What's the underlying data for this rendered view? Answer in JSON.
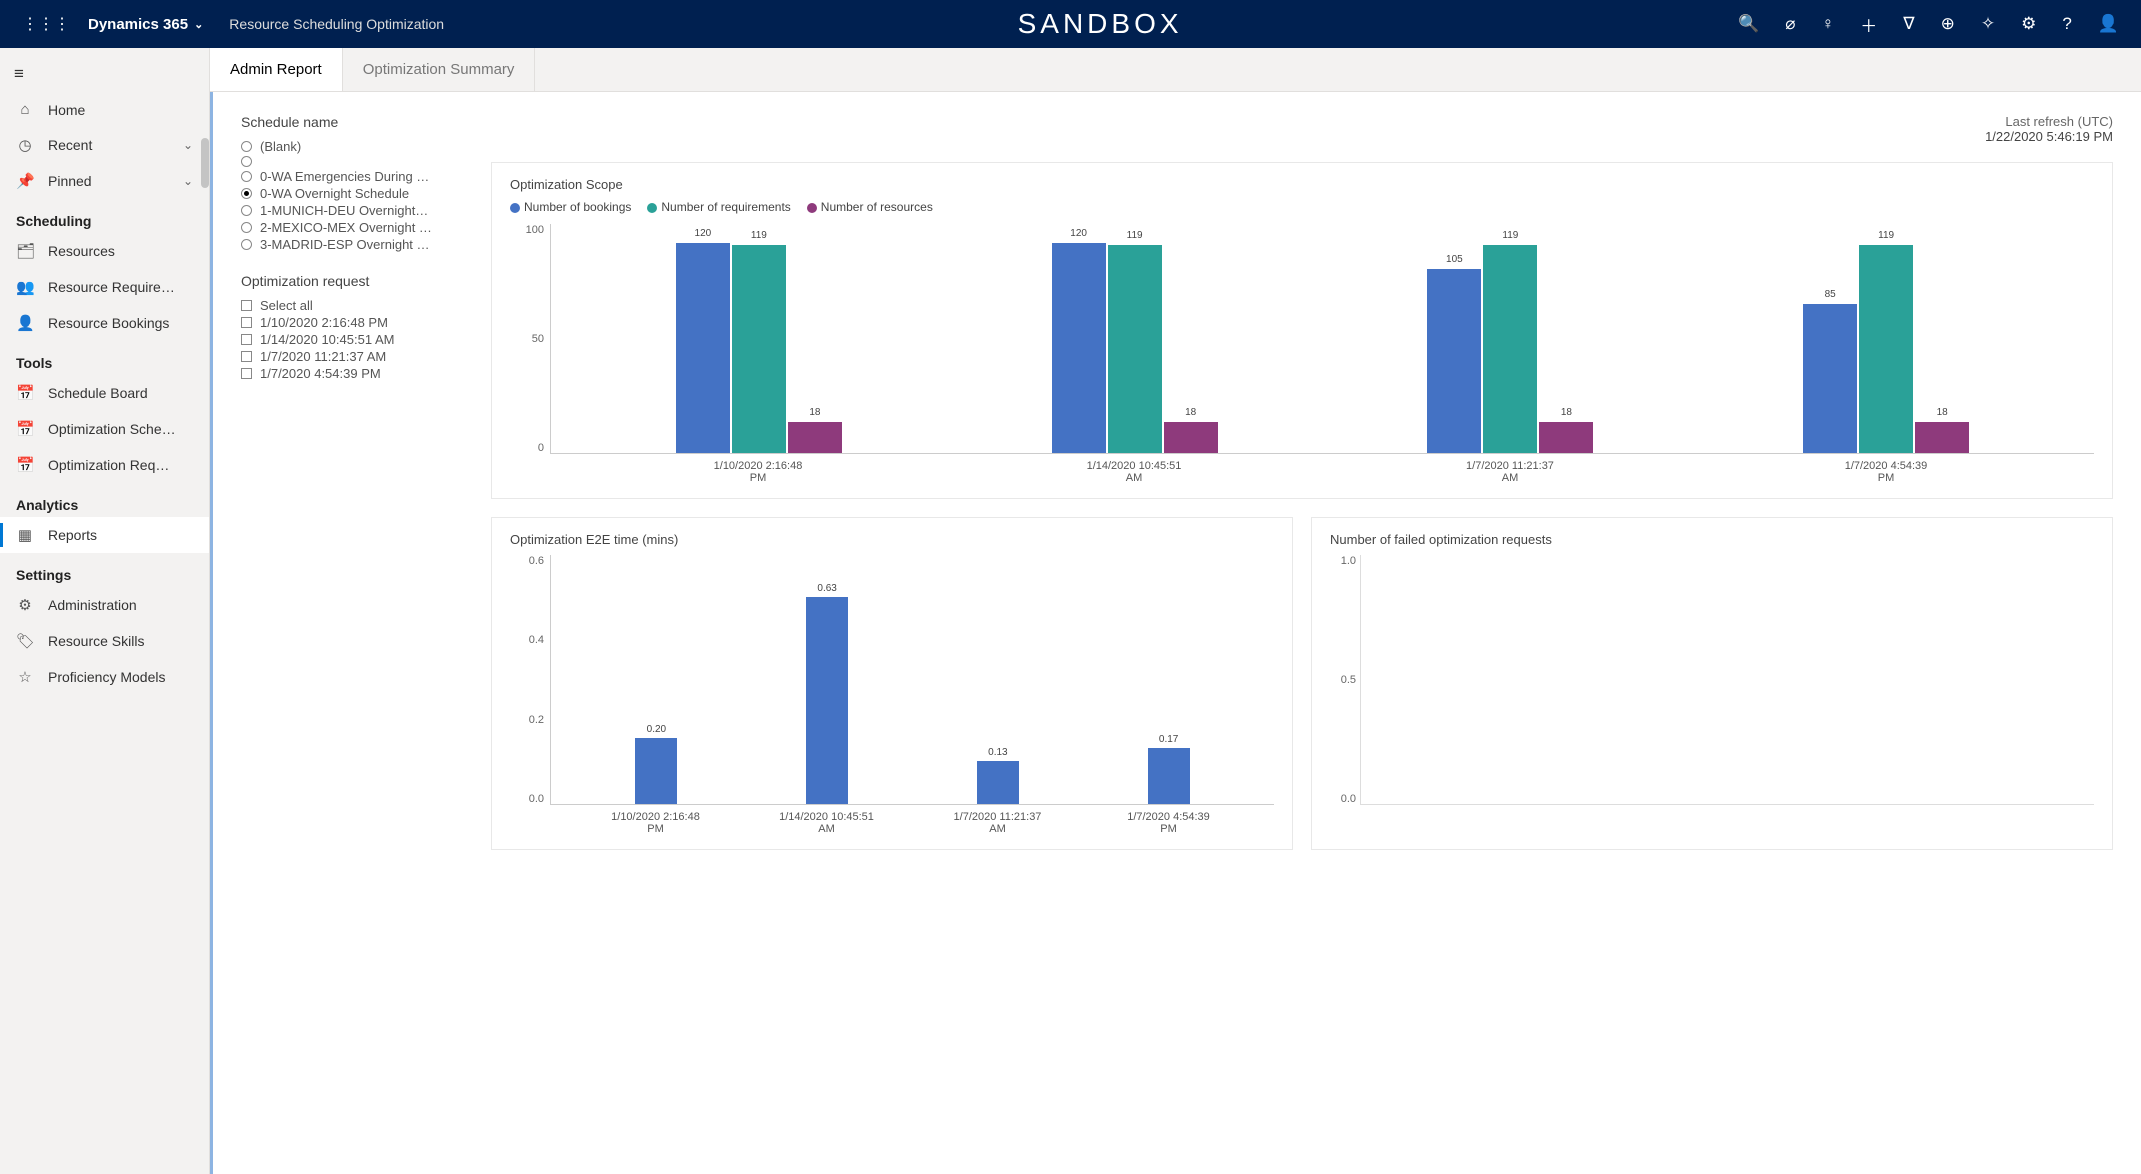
{
  "header": {
    "brand": "Dynamics 365",
    "app": "Resource Scheduling Optimization",
    "sandbox": "SANDBOX"
  },
  "tabs": [
    {
      "label": "Admin Report",
      "active": true
    },
    {
      "label": "Optimization Summary",
      "active": false
    }
  ],
  "sidebar": {
    "home": "Home",
    "recent": "Recent",
    "pinned": "Pinned",
    "groups": {
      "scheduling": "Scheduling",
      "tools": "Tools",
      "analytics": "Analytics",
      "settings": "Settings"
    },
    "items": {
      "resources": "Resources",
      "resourceRequire": "Resource Require…",
      "resourceBookings": "Resource Bookings",
      "scheduleBoard": "Schedule Board",
      "optSched": "Optimization Sche…",
      "optReq": "Optimization Req…",
      "reports": "Reports",
      "admin": "Administration",
      "skills": "Resource Skills",
      "profModels": "Proficiency Models"
    }
  },
  "filters": {
    "scheduleTitle": "Schedule name",
    "schedules": [
      {
        "label": "(Blank)",
        "selected": false
      },
      {
        "label": "",
        "selected": false
      },
      {
        "label": "0-WA Emergencies During …",
        "selected": false
      },
      {
        "label": "0-WA Overnight Schedule",
        "selected": true
      },
      {
        "label": "1-MUNICH-DEU Overnight…",
        "selected": false
      },
      {
        "label": "2-MEXICO-MEX Overnight …",
        "selected": false
      },
      {
        "label": "3-MADRID-ESP Overnight …",
        "selected": false
      }
    ],
    "requestTitle": "Optimization request",
    "selectAll": "Select all",
    "requests": [
      "1/10/2020 2:16:48 PM",
      "1/14/2020 10:45:51 AM",
      "1/7/2020 11:21:37 AM",
      "1/7/2020 4:54:39 PM"
    ]
  },
  "refresh": {
    "label": "Last refresh (UTC)",
    "value": "1/22/2020 5:46:19 PM"
  },
  "chart_data": [
    {
      "type": "bar",
      "title": "Optimization Scope",
      "categories": [
        "1/10/2020 2:16:48 PM",
        "1/14/2020 10:45:51 AM",
        "1/7/2020 11:21:37 AM",
        "1/7/2020 4:54:39 PM"
      ],
      "series": [
        {
          "name": "Number of bookings",
          "color": "#4472c4",
          "values": [
            120,
            120,
            105,
            85
          ]
        },
        {
          "name": "Number of requirements",
          "color": "#2aa198",
          "values": [
            119,
            119,
            119,
            119
          ]
        },
        {
          "name": "Number of resources",
          "color": "#8e3a7c",
          "values": [
            18,
            18,
            18,
            18
          ]
        }
      ],
      "ylim": [
        0,
        120
      ],
      "yticks": [
        0,
        50,
        100
      ]
    },
    {
      "type": "bar",
      "title": "Optimization E2E time (mins)",
      "categories": [
        "1/10/2020 2:16:48 PM",
        "1/14/2020 10:45:51 AM",
        "1/7/2020 11:21:37 AM",
        "1/7/2020 4:54:39 PM"
      ],
      "values": [
        0.2,
        0.63,
        0.13,
        0.17
      ],
      "ylim": [
        0,
        0.7
      ],
      "yticks": [
        0.0,
        0.2,
        0.4,
        0.6
      ]
    },
    {
      "type": "bar",
      "title": "Number of failed optimization requests",
      "categories": [],
      "values": [],
      "ylim": [
        0,
        1.0
      ],
      "yticks": [
        0.0,
        0.5,
        1.0
      ]
    }
  ]
}
